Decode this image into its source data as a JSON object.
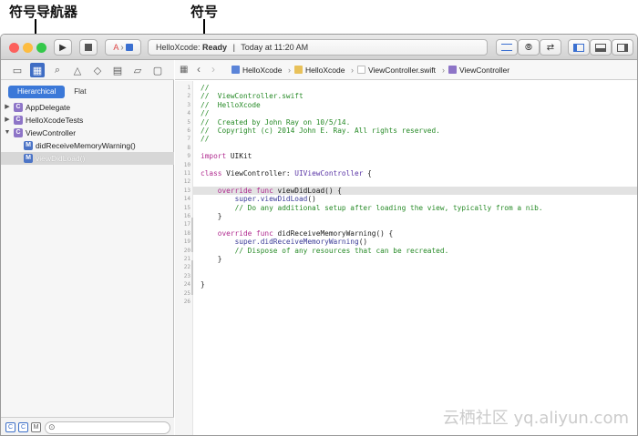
{
  "annotations": {
    "navigator_label": "符号导航器",
    "symbol_label": "符号"
  },
  "toolbar": {
    "scheme_target": "HelloXcode",
    "status_app": "HelloXcode:",
    "status_state": "Ready",
    "status_sep": "|",
    "status_time": "Today at 11:20 AM"
  },
  "navigator": {
    "seg_hierarchical": "Hierarchical",
    "seg_flat": "Flat",
    "items": [
      {
        "label": "AppDelegate",
        "badge": "C"
      },
      {
        "label": "HelloXcodeTests",
        "badge": "C"
      },
      {
        "label": "ViewController",
        "badge": "C"
      },
      {
        "label": "didReceiveMemoryWarning()",
        "badge": "M"
      },
      {
        "label": "viewDidLoad()",
        "badge": "M"
      }
    ],
    "filter_icons": [
      "C",
      "C",
      "M"
    ]
  },
  "jumpbar": {
    "crumbs": [
      "HelloXcode",
      "HelloXcode",
      "ViewController.swift",
      "ViewController"
    ]
  },
  "code": {
    "line_numbers": [
      "1",
      "2",
      "3",
      "4",
      "5",
      "6",
      "7",
      "8",
      "9",
      "10",
      "11",
      "12",
      "13",
      "14",
      "15",
      "16",
      "17",
      "18",
      "19",
      "20",
      "21",
      "22",
      "23",
      "24",
      "25",
      "26"
    ],
    "lines": [
      [
        [
          "com",
          "//"
        ]
      ],
      [
        [
          "com",
          "//  ViewController.swift"
        ]
      ],
      [
        [
          "com",
          "//  HelloXcode"
        ]
      ],
      [
        [
          "com",
          "//"
        ]
      ],
      [
        [
          "com",
          "//  Created by John Ray on 10/5/14."
        ]
      ],
      [
        [
          "com",
          "//  Copyright (c) 2014 John E. Ray. All rights reserved."
        ]
      ],
      [
        [
          "com",
          "//"
        ]
      ],
      [],
      [
        [
          "kw",
          "import"
        ],
        [
          "pl",
          " UIKit"
        ]
      ],
      [],
      [
        [
          "kw",
          "class"
        ],
        [
          "pl",
          " ViewController: "
        ],
        [
          "ty",
          "UIViewController"
        ],
        [
          "pl",
          " {"
        ]
      ],
      [],
      [
        [
          "pl",
          "    "
        ],
        [
          "kw",
          "override func"
        ],
        [
          "pl",
          " viewDidLoad() {"
        ]
      ],
      [
        [
          "pl",
          "        "
        ],
        [
          "fn",
          "super.viewDidLoad"
        ],
        [
          "pl",
          "()"
        ]
      ],
      [
        [
          "pl",
          "        "
        ],
        [
          "com",
          "// Do any additional setup after loading the view, typically from a nib."
        ]
      ],
      [
        [
          "pl",
          "    }"
        ]
      ],
      [],
      [
        [
          "pl",
          "    "
        ],
        [
          "kw",
          "override func"
        ],
        [
          "pl",
          " didReceiveMemoryWarning() {"
        ]
      ],
      [
        [
          "pl",
          "        "
        ],
        [
          "fn",
          "super.didReceiveMemoryWarning"
        ],
        [
          "pl",
          "()"
        ]
      ],
      [
        [
          "pl",
          "        "
        ],
        [
          "com",
          "// Dispose of any resources that can be recreated."
        ]
      ],
      [
        [
          "pl",
          "    }"
        ]
      ],
      [],
      [],
      [
        [
          "pl",
          "}"
        ]
      ],
      [],
      []
    ]
  },
  "watermark": "云栖社区 yq.aliyun.com",
  "colors": {
    "accent": "#3b78d8",
    "comment": "#268a26",
    "keyword": "#b02a8f",
    "type": "#5a35a6",
    "close": "#fc605c",
    "minimize": "#fdbc40",
    "zoom": "#34c84a"
  },
  "icons": [
    "folder-icon",
    "symbol-navigator-icon",
    "search-icon",
    "warning-icon",
    "test-icon",
    "debug-icon",
    "breakpoint-icon",
    "log-icon"
  ]
}
